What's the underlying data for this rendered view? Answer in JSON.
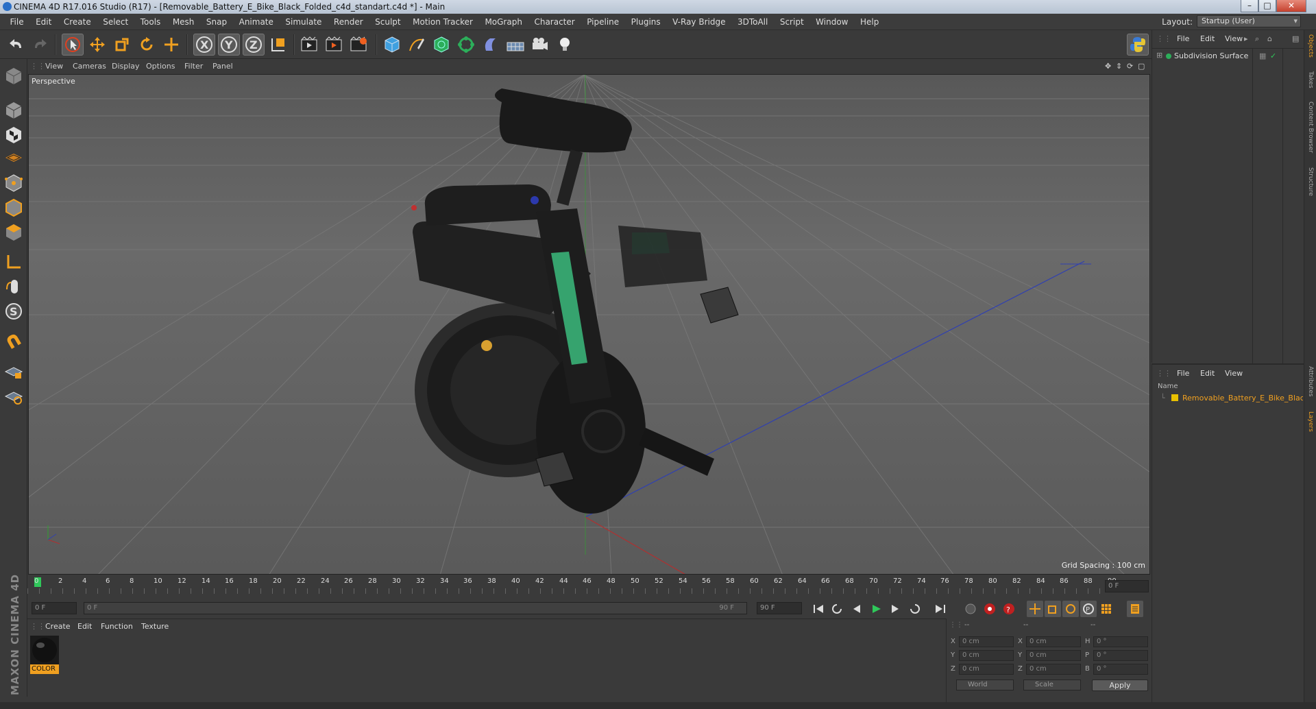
{
  "window": {
    "title": "CINEMA 4D R17.016 Studio (R17) - [Removable_Battery_E_Bike_Black_Folded_c4d_standart.c4d *] - Main",
    "minimize": "–",
    "maximize": "□",
    "close": "✕"
  },
  "menu": [
    "File",
    "Edit",
    "Create",
    "Select",
    "Tools",
    "Mesh",
    "Snap",
    "Animate",
    "Simulate",
    "Render",
    "Sculpt",
    "Motion Tracker",
    "MoGraph",
    "Character",
    "Pipeline",
    "Plugins",
    "V-Ray Bridge",
    "3DToAll",
    "Script",
    "Window",
    "Help"
  ],
  "layout": {
    "label": "Layout:",
    "value": "Startup (User)"
  },
  "viewport": {
    "menu": [
      "View",
      "Cameras",
      "Display",
      "Options",
      "Filter",
      "Panel"
    ],
    "camera": "Perspective",
    "grid_spacing": "Grid Spacing : 100 cm"
  },
  "timeline": {
    "ticks": [
      "0",
      "2",
      "4",
      "6",
      "8",
      "10",
      "12",
      "14",
      "16",
      "18",
      "20",
      "22",
      "24",
      "26",
      "28",
      "30",
      "32",
      "34",
      "36",
      "38",
      "40",
      "42",
      "44",
      "46",
      "48",
      "50",
      "52",
      "54",
      "56",
      "58",
      "60",
      "62",
      "64",
      "66",
      "68",
      "70",
      "72",
      "74",
      "76",
      "78",
      "80",
      "82",
      "84",
      "86",
      "88",
      "90"
    ],
    "current_frame": "0 F",
    "start_field": "0 F",
    "range_start": "0 F",
    "range_end": "90 F",
    "end_field": "90 F"
  },
  "material_manager": {
    "menu": [
      "Create",
      "Edit",
      "Function",
      "Texture"
    ],
    "materials": [
      {
        "name": "COLOR"
      }
    ]
  },
  "coordinates": {
    "header": [
      "--",
      "--",
      "--"
    ],
    "rows": [
      {
        "axis": "X",
        "pos": "0 cm",
        "axis2": "X",
        "size": "0 cm",
        "rot_label": "H",
        "rot": "0 °"
      },
      {
        "axis": "Y",
        "pos": "0 cm",
        "axis2": "Y",
        "size": "0 cm",
        "rot_label": "P",
        "rot": "0 °"
      },
      {
        "axis": "Z",
        "pos": "0 cm",
        "axis2": "Z",
        "size": "0 cm",
        "rot_label": "B",
        "rot": "0 °"
      }
    ],
    "mode": "World",
    "size_mode": "Scale",
    "apply": "Apply"
  },
  "object_manager": {
    "menu": [
      "File",
      "Edit",
      "View"
    ],
    "objects": [
      {
        "name": "Subdivision Surface"
      }
    ]
  },
  "layer_manager": {
    "menu": [
      "File",
      "Edit",
      "View"
    ],
    "column": "Name",
    "items": [
      {
        "name": "Removable_Battery_E_Bike_Black_"
      }
    ]
  },
  "side_tabs": [
    "Objects",
    "Takes",
    "Content Browser",
    "Structure",
    "Attributes",
    "Layers"
  ],
  "branding": "MAXON CINEMA 4D",
  "colors": {
    "accent": "#f0a020",
    "layer_color": "#e8c000",
    "x_axis": "#b03030",
    "y_axis": "#30a030",
    "z_axis": "#3040b0",
    "battery_glow": "#3fd08a"
  }
}
